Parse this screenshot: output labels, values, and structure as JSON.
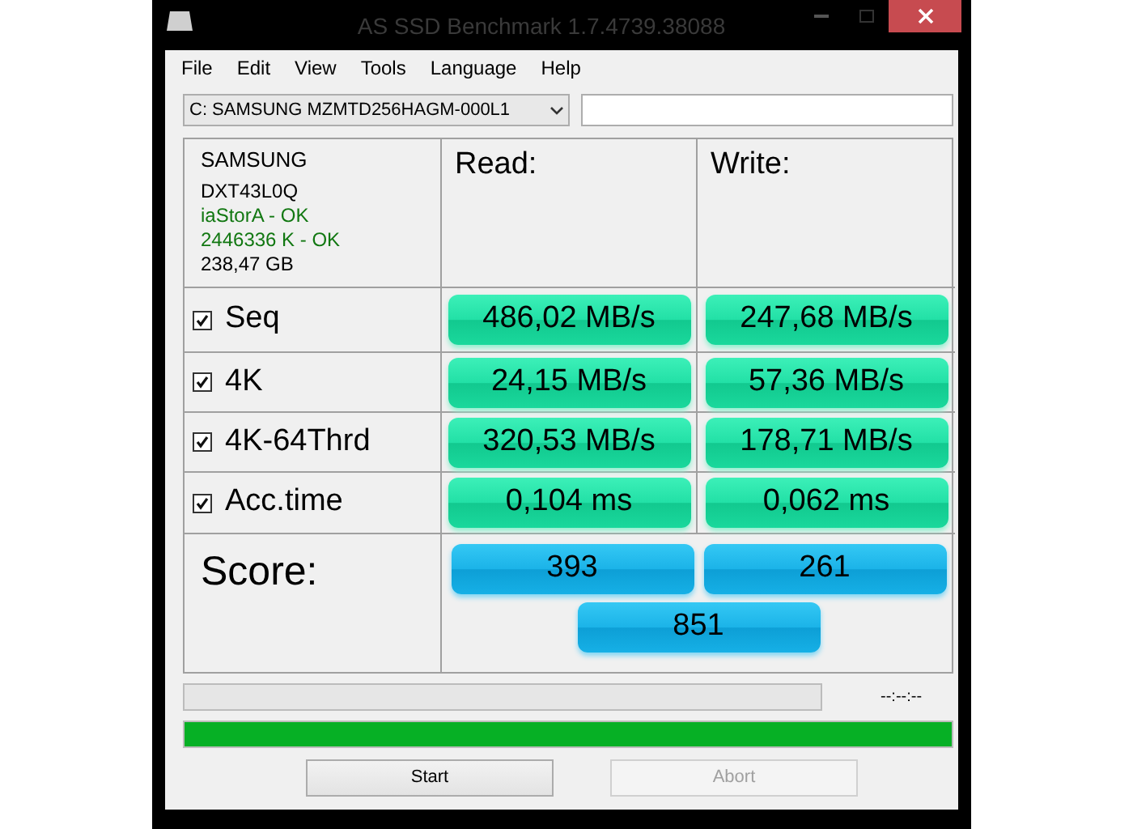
{
  "window": {
    "title": "AS SSD Benchmark 1.7.4739.38088"
  },
  "menu": [
    "File",
    "Edit",
    "View",
    "Tools",
    "Language",
    "Help"
  ],
  "drive_select": {
    "value": "C: SAMSUNG MZMTD256HAGM-000L1"
  },
  "drive_info": [
    {
      "text": "SAMSUNG",
      "kind": "plain"
    },
    {
      "text": "DXT43L0Q",
      "kind": "plain"
    },
    {
      "text": "iaStorA - OK",
      "kind": "ok"
    },
    {
      "text": "2446336 K - OK",
      "kind": "ok"
    },
    {
      "text": "238,47 GB",
      "kind": "plain"
    }
  ],
  "headers": {
    "read": "Read:",
    "write": "Write:"
  },
  "tests": [
    {
      "label": "Seq",
      "checked": true,
      "read": "486,02 MB/s",
      "write": "247,68 MB/s"
    },
    {
      "label": "4K",
      "checked": true,
      "read": "24,15 MB/s",
      "write": "57,36 MB/s"
    },
    {
      "label": "4K-64Thrd",
      "checked": true,
      "read": "320,53 MB/s",
      "write": "178,71 MB/s"
    },
    {
      "label": "Acc.time",
      "checked": true,
      "read": "0,104 ms",
      "write": "0,062 ms"
    }
  ],
  "score": {
    "label": "Score:",
    "read": "393",
    "write": "261",
    "total": "851"
  },
  "progress": {
    "level": 0,
    "time": "--:--:--"
  },
  "total_progress": {
    "level": 1
  },
  "buttons": [
    {
      "label": "Start",
      "disabled": false
    },
    {
      "label": "Abort",
      "disabled": true
    }
  ]
}
